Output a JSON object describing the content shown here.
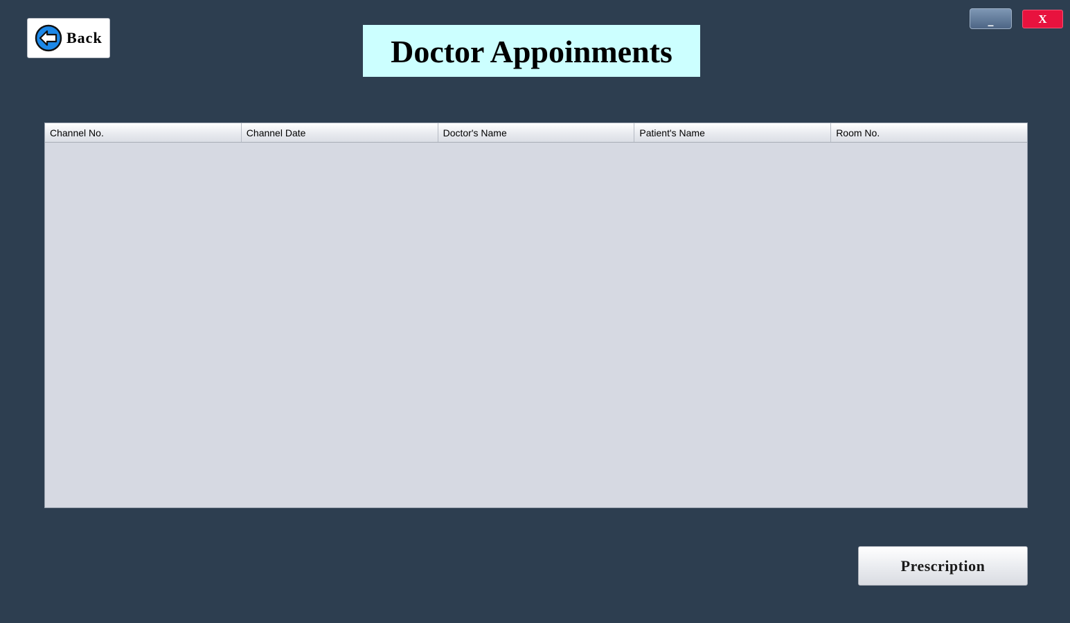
{
  "window": {
    "title": "Doctor Appoinments",
    "minimize_label": "_",
    "close_label": "X"
  },
  "nav": {
    "back_label": "Back",
    "back_icon": "back-arrow-icon"
  },
  "table": {
    "columns": [
      "Channel No.",
      "Channel Date",
      "Doctor's Name",
      "Patient's Name",
      "Room No."
    ],
    "rows": []
  },
  "actions": {
    "prescription_label": "Prescription"
  },
  "colors": {
    "background": "#2d3e50",
    "title_background": "#ccffff",
    "close_button": "#e8123e",
    "table_background": "#d6d9e2"
  }
}
